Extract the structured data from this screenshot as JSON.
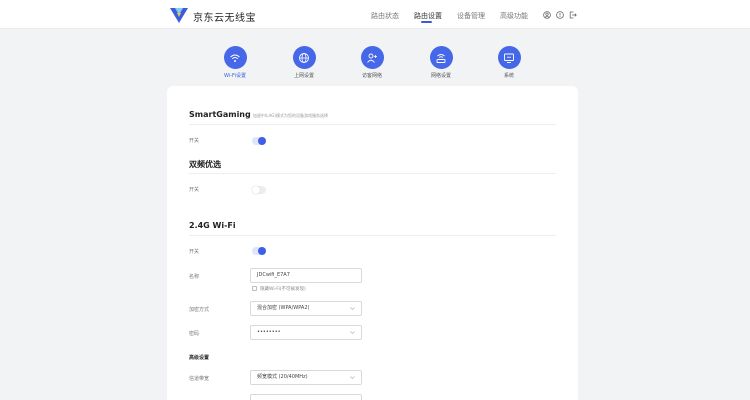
{
  "header": {
    "brand": "京东云无线宝",
    "nav": [
      "路由状态",
      "路由设置",
      "设备管理",
      "高级功能"
    ],
    "active_nav": "路由设置"
  },
  "tabs": [
    {
      "label": "Wi-Fi设置",
      "icon": "wifi-icon",
      "active": true
    },
    {
      "label": "上网设置",
      "icon": "globe-icon",
      "active": false
    },
    {
      "label": "访客网络",
      "icon": "guest-user-icon",
      "active": false
    },
    {
      "label": "网络设置",
      "icon": "router-icon",
      "active": false
    },
    {
      "label": "系统",
      "icon": "monitor-icon",
      "active": false
    }
  ],
  "smart_gaming": {
    "title": "SmartGaming",
    "desc": "加速中(LAG)模式为您的设备游戏服务选择",
    "switch_label": "开关",
    "enabled": true
  },
  "dual_band": {
    "title": "双频优选",
    "switch_label": "开关",
    "enabled": false
  },
  "wifi_24g": {
    "title": "2.4G Wi-Fi",
    "switch_label": "开关",
    "enabled": true,
    "name_label": "名称",
    "name_value": "JDCwifi_E7A7",
    "hide_label": "隐藏Wi-Fi(不可被发现)",
    "hide_checked": false,
    "encryption_label": "加密方式",
    "encryption_value": "混合加密 (WPA/WPA2)",
    "password_label": "密码",
    "password_value": "••••••••",
    "advanced_label": "高级设置",
    "bandwidth_label": "信道带宽",
    "bandwidth_value": "频宽模式 (20/40MHz)"
  },
  "colors": {
    "accent": "#3c5ce0",
    "tab_circle": "#4667e8",
    "background": "#f2f3f5"
  }
}
